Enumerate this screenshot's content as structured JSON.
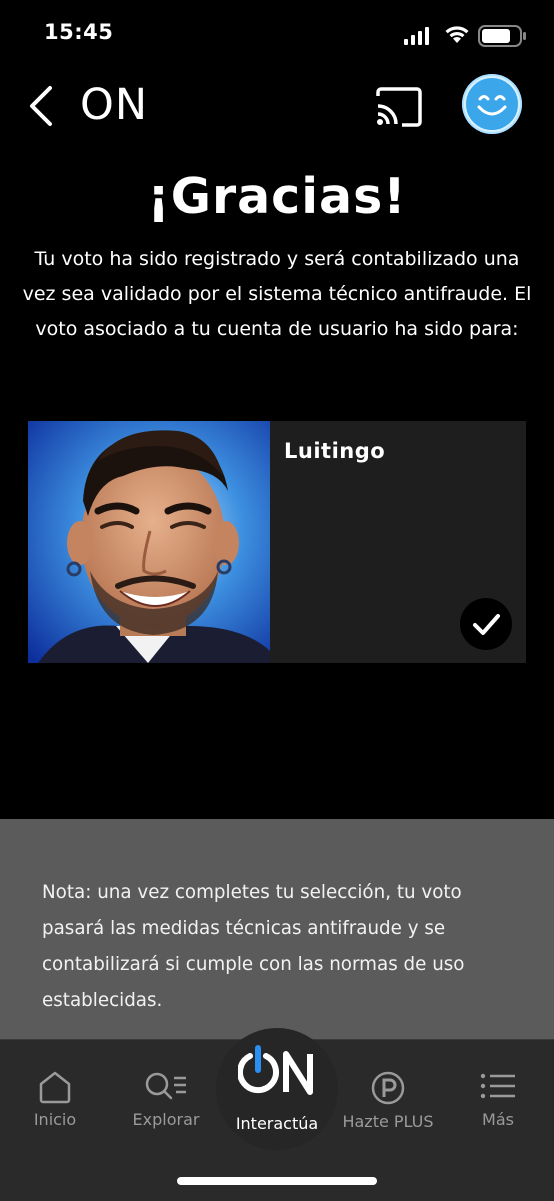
{
  "status_bar": {
    "time": "15:45"
  },
  "nav": {
    "logo_text": "ON",
    "back_icon": "chevron-left-icon",
    "cast_icon": "cast-icon",
    "avatar_icon": "smiley-icon"
  },
  "thanks": {
    "title": "¡Gracias!",
    "body": "Tu voto ha sido registrado y será contabilizado una vez sea validado por el sistema técnico antifraude. El voto asociado a tu cuenta de usuario ha sido para:"
  },
  "candidate": {
    "name": "Luitingo",
    "selected": true
  },
  "note": {
    "text": "Nota: una vez completes tu selección, tu voto pasará las medidas técnicas antifraude y se contabilizará si cumple con las normas de uso establecidas."
  },
  "tabs": [
    {
      "label": "Inicio",
      "icon": "home-icon"
    },
    {
      "label": "Explorar",
      "icon": "search-list-icon"
    },
    {
      "label": "Interactúa",
      "icon": "on-logo-icon"
    },
    {
      "label": "Hazte PLUS",
      "icon": "plus-p-icon"
    },
    {
      "label": "Más",
      "icon": "menu-list-icon"
    }
  ],
  "colors": {
    "background": "#000000",
    "card": "#1e1e1e",
    "note_bg": "#5b5b5b",
    "tabbar_bg": "#2a2a2a",
    "accent_blue": "#3ba6ea"
  }
}
